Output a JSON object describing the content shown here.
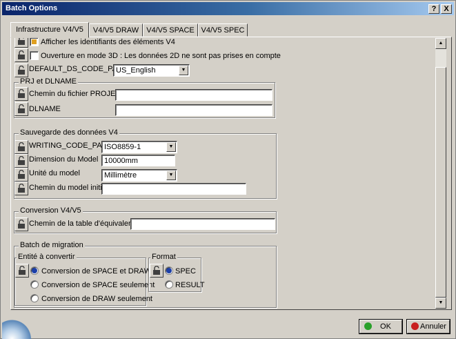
{
  "window": {
    "title": "Batch Options",
    "help_glyph": "?",
    "close_glyph": "X"
  },
  "tabs": [
    {
      "label": "Infrastructure V4/V5",
      "active": true
    },
    {
      "label": "V4/V5 DRAW",
      "active": false
    },
    {
      "label": "V4/V5 SPACE",
      "active": false
    },
    {
      "label": "V4/V5 SPEC",
      "active": false
    }
  ],
  "top_options": {
    "show_identifiers": {
      "label": "Afficher les identifiants des éléments V4",
      "checked": true
    },
    "open_3d_mode": {
      "label": "Ouverture en mode 3D : Les données 2D ne sont pas prises en compte",
      "checked": false
    },
    "default_ds_code_page": {
      "label": "DEFAULT_DS_CODE_PAGE",
      "value": "US_English"
    }
  },
  "prj_group": {
    "title": "PRJ et DLNAME",
    "project_file": {
      "label": "Chemin du fichier PROJECT",
      "value": ""
    },
    "dlname": {
      "label": "DLNAME",
      "value": ""
    }
  },
  "save_group": {
    "title": "Sauvegarde des données V4",
    "writing_code_page": {
      "label": "WRITING_CODE_PAGE",
      "value": "ISO8859-1"
    },
    "model_dimension": {
      "label": "Dimension du Model",
      "value": "10000mm"
    },
    "model_unit": {
      "label": "Unité du model",
      "value": "Millimètre"
    },
    "initial_model_path": {
      "label": "Chemin du model initial",
      "value": ""
    }
  },
  "conversion_group": {
    "title": "Conversion V4/V5",
    "equivalence_table": {
      "label": "Chemin de la table d'équivalence",
      "value": ""
    }
  },
  "migration_group": {
    "title": "Batch de migration",
    "entity": {
      "title": "Entité à convertir",
      "options": [
        {
          "label": "Conversion de SPACE et DRAW",
          "selected": true
        },
        {
          "label": "Conversion de SPACE seulement",
          "selected": false
        },
        {
          "label": "Conversion de DRAW seulement",
          "selected": false
        }
      ]
    },
    "format": {
      "title": "Format",
      "options": [
        {
          "label": "SPEC",
          "selected": true
        },
        {
          "label": "RESULT",
          "selected": false
        }
      ]
    }
  },
  "footer": {
    "ok_label": "OK",
    "ok_color": "#2aa02a",
    "cancel_label": "Annuler",
    "cancel_color": "#c82020"
  },
  "icons": {
    "lock": "lock-icon",
    "combo_arrow": "▼",
    "scroll_up": "▲",
    "scroll_down": "▼"
  }
}
